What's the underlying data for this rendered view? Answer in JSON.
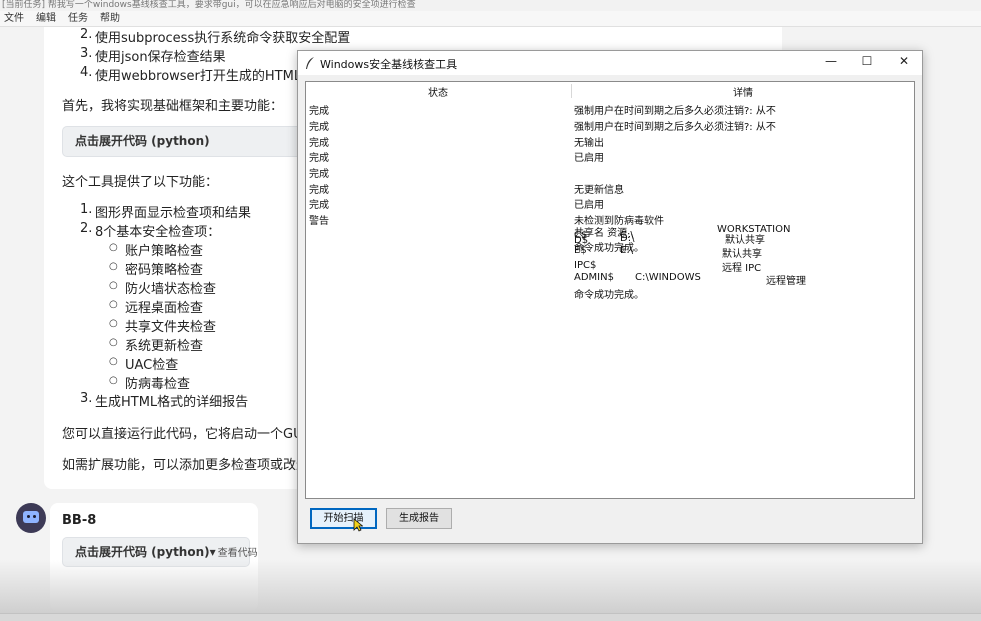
{
  "app": {
    "title": "[当前任务] 帮我写一个windows基线核查工具，要求带gui，可以在应急响应后对电脑的安全项进行检查",
    "menu": [
      "文件",
      "编辑",
      "任务",
      "帮助"
    ]
  },
  "chat": {
    "list_top": [
      {
        "num": "2.",
        "text": "使用subprocess执行系统命令获取安全配置"
      },
      {
        "num": "3.",
        "text": "使用json保存检查结果"
      },
      {
        "num": "4.",
        "text": "使用webbrowser打开生成的HTML报告"
      }
    ],
    "intro": "首先，我将实现基础框架和主要功能：",
    "code_label": "点击展开代码 (python)",
    "features_intro": "这个工具提供了以下功能：",
    "features": [
      {
        "num": "1.",
        "text": "图形界面显示检查项和结果"
      },
      {
        "num": "2.",
        "text": "8个基本安全检查项："
      }
    ],
    "checks": [
      "账户策略检查",
      "密码策略检查",
      "防火墙状态检查",
      "远程桌面检查",
      "共享文件夹检查",
      "系统更新检查",
      "UAC检查",
      "防病毒检查"
    ],
    "feature3": {
      "num": "3.",
      "text": "生成HTML格式的详细报告"
    },
    "run_note": "您可以直接运行此代码，它将启动一个GUI",
    "extend_note": "如需扩展功能，可以添加更多检查项或改进"
  },
  "bot": {
    "name": "BB-8",
    "code_label": "点击展开代码 (python)▾",
    "view_code": "查看代码"
  },
  "dialog": {
    "title": "Windows安全基线核查工具",
    "columns": {
      "status": "状态",
      "detail": "详情"
    },
    "rows": [
      {
        "status": "完成",
        "detail": "强制用户在时间到期之后多久必须注销?:     从不"
      },
      {
        "status": "完成",
        "detail": "强制用户在时间到期之后多久必须注销?:     从不"
      },
      {
        "status": "完成",
        "detail": "无输出"
      },
      {
        "status": "完成",
        "detail": "已启用"
      },
      {
        "status": "完成",
        "detail": ""
      },
      {
        "status": "完成",
        "detail": "无更新信息"
      },
      {
        "status": "完成",
        "detail": "已启用"
      },
      {
        "status": "警告",
        "detail": "未检测到防病毒软件"
      }
    ],
    "overflow": {
      "line1_left": "共享名       资源",
      "line1_right": "WORKSTATION",
      "line2a": "C$",
      "line2b": "C:\\",
      "line2c": "默认共享",
      "line3a": "D$",
      "line3b": "D:\\",
      "line3c": "命令成功完成。",
      "line4a": "E$",
      "line4b": "E:\\",
      "line4c": "默认共享",
      "line5a": "IPC$",
      "line5c": "远程 IPC",
      "line6a": "ADMIN$",
      "line6b": "C:\\WINDOWS",
      "line6c": "远程管理",
      "line7": "命令成功完成。"
    },
    "buttons": {
      "scan": "开始扫描",
      "report": "生成报告"
    },
    "controls": {
      "minimize": "—",
      "maximize": "☐",
      "close": "✕"
    }
  }
}
